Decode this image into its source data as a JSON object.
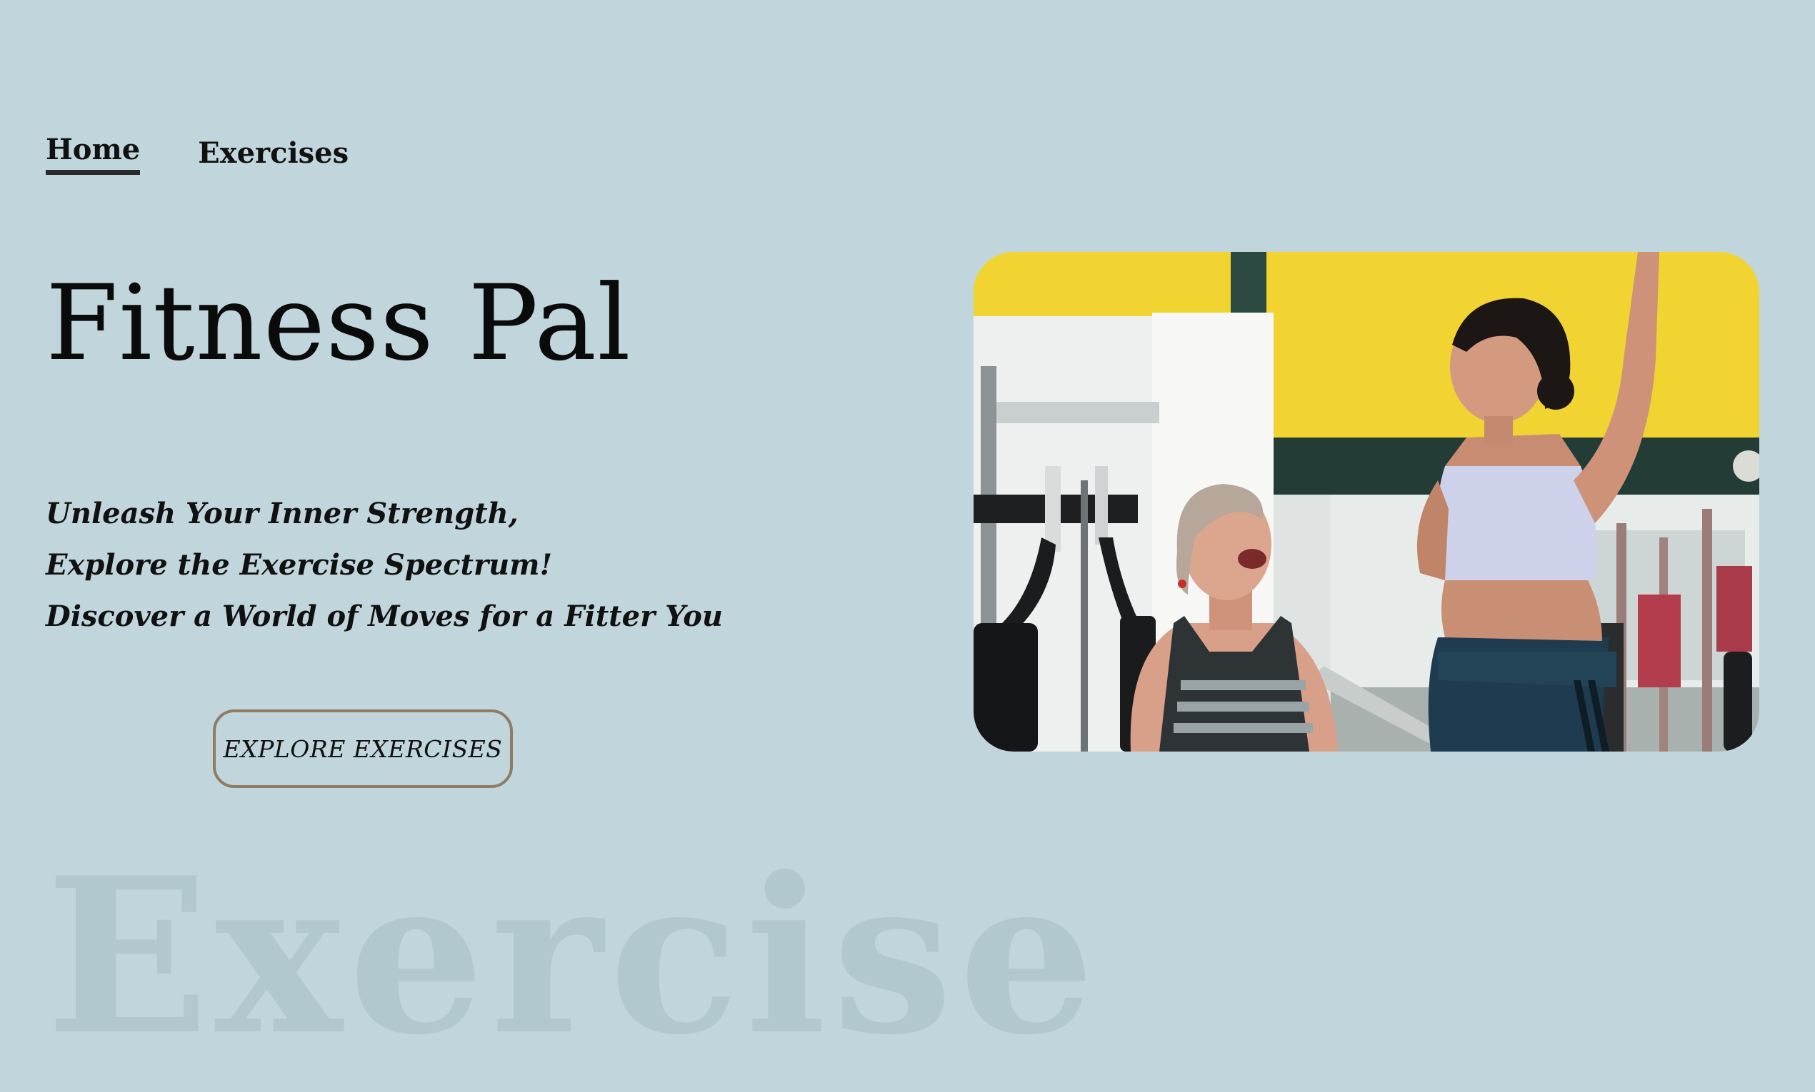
{
  "nav": {
    "items": [
      {
        "label": "Home",
        "active": true
      },
      {
        "label": "Exercises",
        "active": false
      }
    ]
  },
  "hero": {
    "title": "Fitness Pal",
    "tagline": [
      "Unleash Your Inner Strength,",
      "Explore the Exercise Spectrum!",
      "Discover a World of Moves for a Fitter You"
    ],
    "cta_label": "EXPLORE EXERCISES",
    "watermark": "Exercise",
    "image_alt": "Two women laughing in a gym"
  },
  "colors": {
    "background": "#c0d6dc",
    "cta_border": "#8f7c62",
    "watermark": "#b2c8cf",
    "gym_wall_yellow": "#f1d431",
    "gym_stripe_green": "#233c35"
  }
}
